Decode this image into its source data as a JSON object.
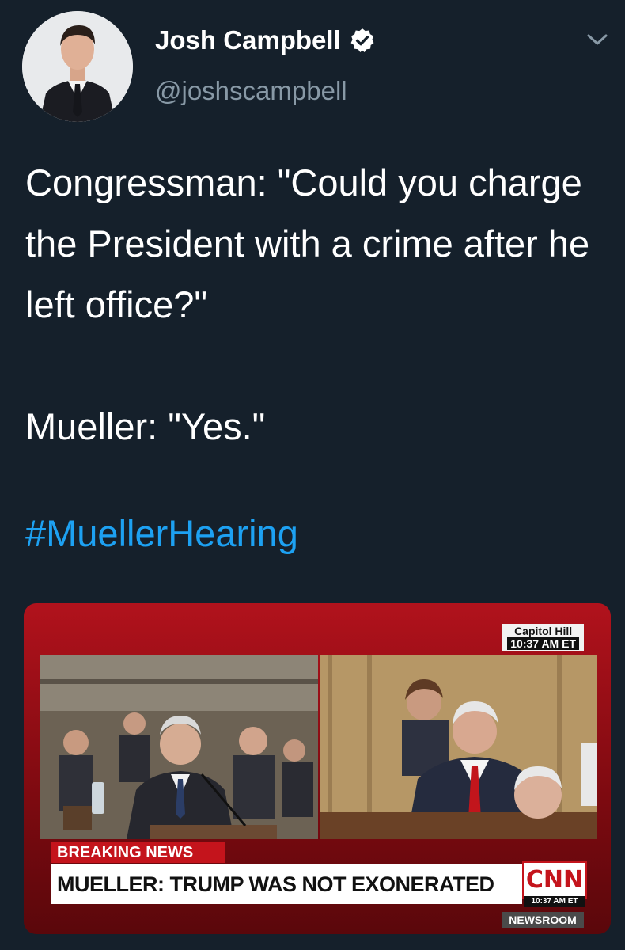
{
  "author": {
    "display_name": "Josh Campbell",
    "handle": "@joshscampbell",
    "verified": true,
    "avatar_icon": "profile-photo"
  },
  "tweet": {
    "lines": [
      "Congressman: \"Could you charge the President with a crime after he left office?\"",
      "Mueller: \"Yes.\""
    ],
    "hashtag": "#MuellerHearing"
  },
  "media": {
    "location_label": "Capitol Hill",
    "location_time": "10:37 AM ET",
    "breaking_label": "BREAKING NEWS",
    "headline": "MUELLER: TRUMP WAS NOT EXONERATED",
    "network_logo": "CNN",
    "logo_time": "10:37 AM ET",
    "show_name": "NEWSROOM"
  },
  "colors": {
    "background": "#15202b",
    "text": "#ffffff",
    "secondary_text": "#8899a6",
    "link": "#1da1f2",
    "verified_badge": "#ffffff",
    "cnn_red": "#c4141c"
  }
}
